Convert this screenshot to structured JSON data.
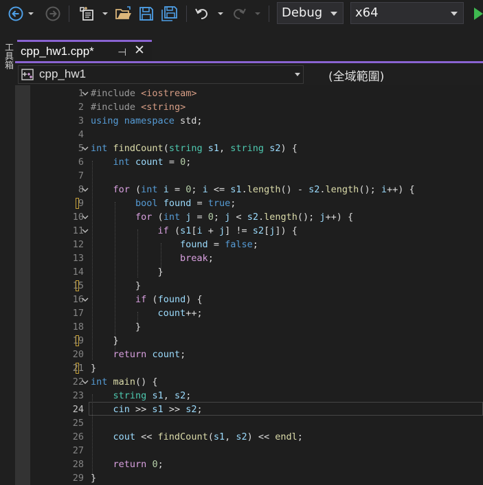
{
  "toolbar": {
    "config": "Debug",
    "platform": "x64"
  },
  "side_panel_label": "工具箱",
  "tab": {
    "filename": "cpp_hw1.cpp*",
    "pin_glyph": "⊣",
    "close_glyph": "✕"
  },
  "nav": {
    "project": "cpp_hw1",
    "scope": "(全域範圍)"
  },
  "editor": {
    "current_line": 24,
    "line_numbers": [
      "1",
      "2",
      "3",
      "4",
      "5",
      "6",
      "7",
      "8",
      "9",
      "10",
      "11",
      "12",
      "13",
      "14",
      "15",
      "16",
      "17",
      "18",
      "19",
      "20",
      "21",
      "22",
      "23",
      "24",
      "25",
      "26",
      "27",
      "28",
      "29"
    ],
    "lines": [
      "#include <iostream>",
      "#include <string>",
      "using namespace std;",
      "",
      "int findCount(string s1, string s2) {",
      "    int count = 0;",
      "",
      "    for (int i = 0; i <= s1.length() - s2.length(); i++) {",
      "        bool found = true;",
      "        for (int j = 0; j < s2.length(); j++) {",
      "            if (s1[i + j] != s2[j]) {",
      "                found = false;",
      "                break;",
      "            }",
      "        }",
      "        if (found) {",
      "            count++;",
      "        }",
      "    }",
      "    return count;",
      "}",
      "int main() {",
      "    string s1, s2;",
      "    cin >> s1 >> s2;",
      "",
      "    cout << findCount(s1, s2) << endl;",
      "",
      "    return 0;",
      "}"
    ]
  },
  "colors": {
    "accent": "#8a63d2",
    "keyword": "#569cd6",
    "type": "#4ec9b0",
    "function": "#dcdcaa",
    "string": "#d69d85",
    "control": "#d8a0df",
    "variable": "#9cdcfe",
    "number": "#b5cea8",
    "run_green": "#3fb950",
    "nav_blue": "#4e9fe6",
    "save_blue": "#4e9fe6",
    "folder_yellow": "#dcb67a"
  }
}
